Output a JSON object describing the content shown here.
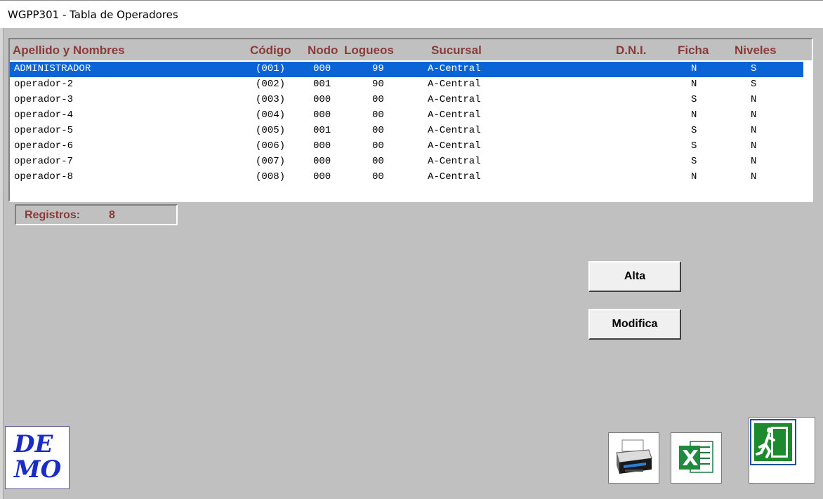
{
  "window": {
    "title": "WGPP301 - Tabla de Operadores"
  },
  "grid": {
    "headers": [
      "Apellido y Nombres",
      "Código",
      "Nodo",
      "Logueos",
      "Sucursal",
      "D.N.I.",
      "Ficha",
      "Niveles"
    ],
    "rows": [
      {
        "nombre": "ADMINISTRADOR",
        "codigo": "(001)",
        "nodo": "000",
        "logueos": "99",
        "sucursal": "A-Central",
        "dni": "",
        "ficha": "N",
        "niveles": "S",
        "selected": true
      },
      {
        "nombre": "operador-2",
        "codigo": "(002)",
        "nodo": "001",
        "logueos": "90",
        "sucursal": "A-Central",
        "dni": "",
        "ficha": "N",
        "niveles": "S"
      },
      {
        "nombre": "operador-3",
        "codigo": "(003)",
        "nodo": "000",
        "logueos": "00",
        "sucursal": "A-Central",
        "dni": "",
        "ficha": "S",
        "niveles": "N"
      },
      {
        "nombre": "operador-4",
        "codigo": "(004)",
        "nodo": "000",
        "logueos": "00",
        "sucursal": "A-Central",
        "dni": "",
        "ficha": "N",
        "niveles": "N"
      },
      {
        "nombre": "operador-5",
        "codigo": "(005)",
        "nodo": "001",
        "logueos": "00",
        "sucursal": "A-Central",
        "dni": "",
        "ficha": "S",
        "niveles": "N"
      },
      {
        "nombre": "operador-6",
        "codigo": "(006)",
        "nodo": "000",
        "logueos": "00",
        "sucursal": "A-Central",
        "dni": "",
        "ficha": "S",
        "niveles": "N"
      },
      {
        "nombre": "operador-7",
        "codigo": "(007)",
        "nodo": "000",
        "logueos": "00",
        "sucursal": "A-Central",
        "dni": "",
        "ficha": "S",
        "niveles": "N"
      },
      {
        "nombre": "operador-8",
        "codigo": "(008)",
        "nodo": "000",
        "logueos": "00",
        "sucursal": "A-Central",
        "dni": "",
        "ficha": "N",
        "niveles": "N"
      }
    ]
  },
  "registros": {
    "label": "Registros:",
    "count": "8"
  },
  "buttons": {
    "alta": "Alta",
    "modifica": "Modifica"
  },
  "icons": {
    "print": "printer-icon",
    "excel": "excel-icon",
    "exit": "exit-icon"
  },
  "demo": {
    "line1": "DE",
    "line2": "MO"
  },
  "colors": {
    "header_text": "#8b3a3a",
    "selection": "#0a64d6",
    "background": "#c0c0c0",
    "demo_text": "#1a2cc8",
    "exit_green": "#1e8a2e"
  }
}
